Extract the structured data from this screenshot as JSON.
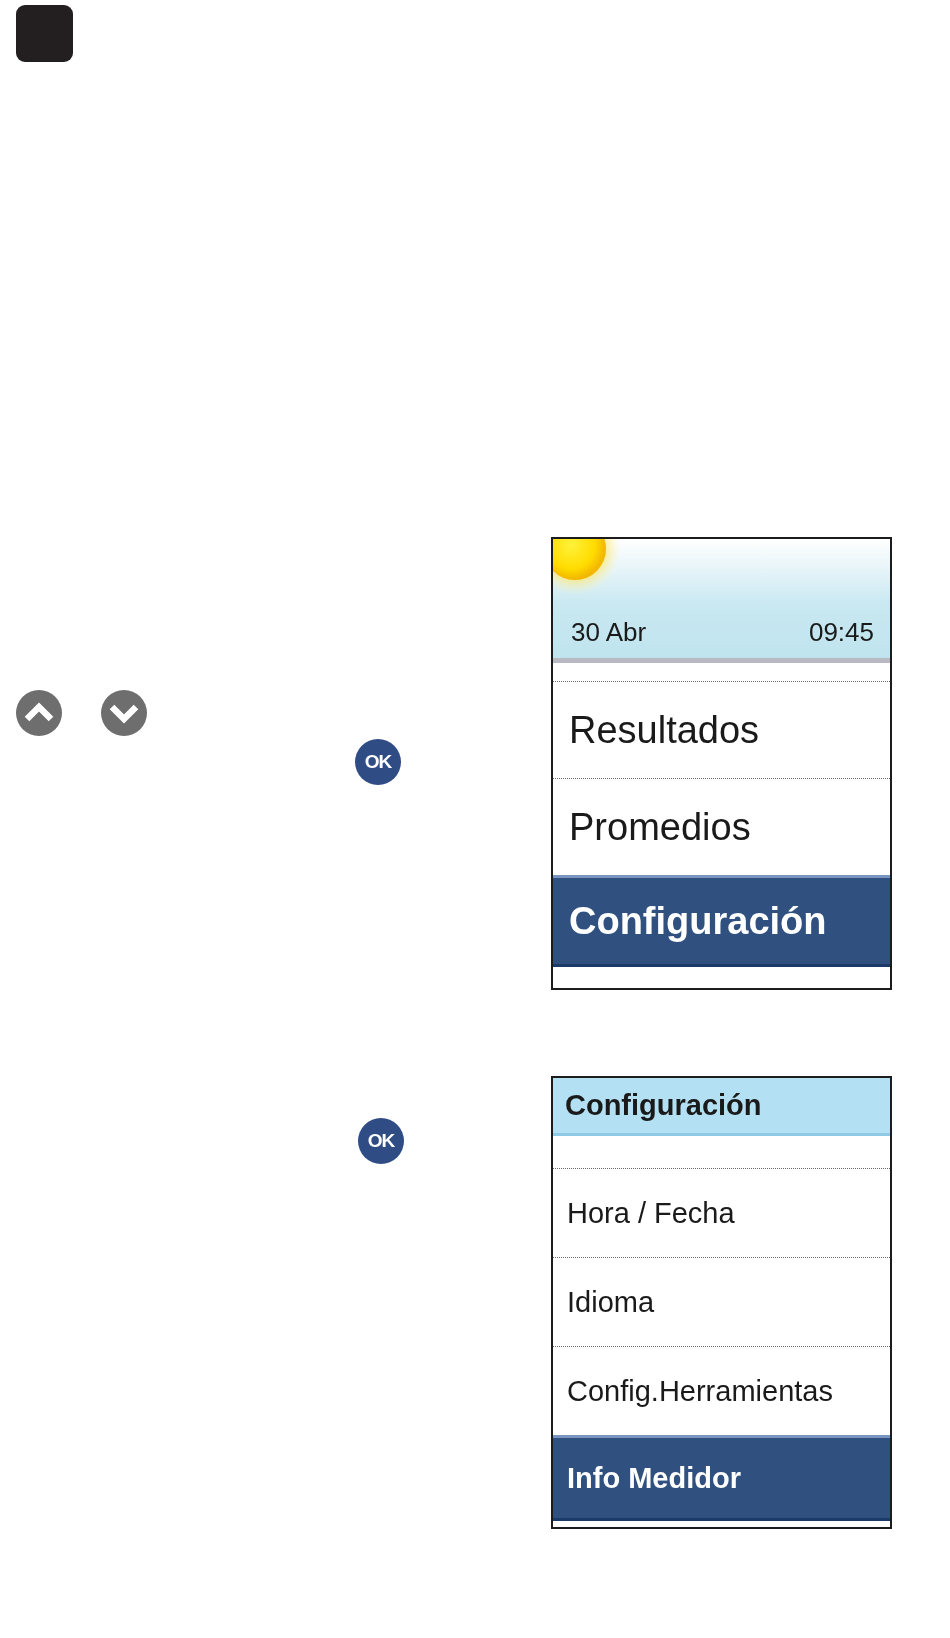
{
  "steps": [
    {
      "keys": [
        {
          "kind": "up"
        },
        {
          "kind": "down"
        }
      ],
      "ok_button": {
        "label": "OK"
      },
      "screen": {
        "kind": "home",
        "date": "30 Abr",
        "time": "09:45",
        "items": [
          {
            "label": "Resultados",
            "selected": false
          },
          {
            "label": "Promedios",
            "selected": false
          },
          {
            "label": "Configuración",
            "selected": true
          }
        ]
      }
    },
    {
      "ok_button": {
        "label": "OK"
      },
      "screen": {
        "kind": "menu",
        "title": "Configuración",
        "items": [
          {
            "label": "Hora / Fecha",
            "selected": false
          },
          {
            "label": "Idioma",
            "selected": false
          },
          {
            "label": "Config.Herramientas",
            "selected": false
          },
          {
            "label": "Info Medidor",
            "selected": true
          }
        ]
      }
    }
  ]
}
